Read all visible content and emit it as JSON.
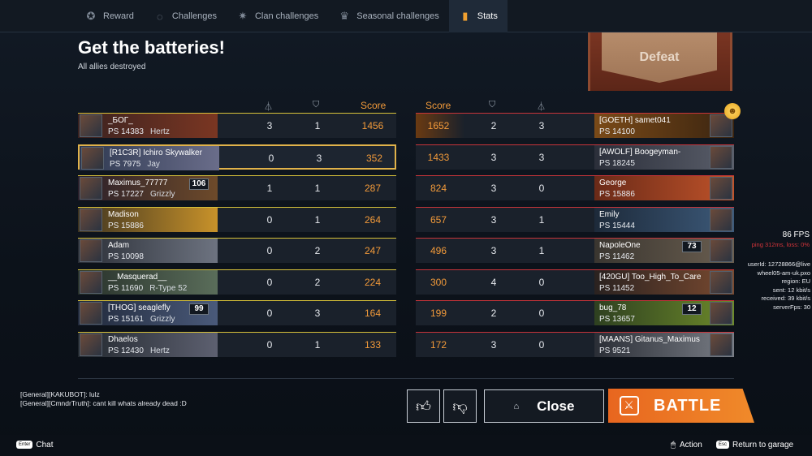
{
  "nav": {
    "tabs": [
      {
        "label": "Reward",
        "icon": "reward-icon"
      },
      {
        "label": "Challenges",
        "icon": "challenges-icon"
      },
      {
        "label": "Clan challenges",
        "icon": "clan-challenges-icon"
      },
      {
        "label": "Seasonal challenges",
        "icon": "seasonal-challenges-icon"
      },
      {
        "label": "Stats",
        "icon": "stats-icon"
      }
    ],
    "active": "Stats"
  },
  "mission": {
    "title": "Get the batteries!",
    "subtitle": "All allies destroyed"
  },
  "result": {
    "label": "Defeat"
  },
  "columns": {
    "score": "Score"
  },
  "colors": {
    "accent": "#f29a3a",
    "ally_line": "#d8c23a",
    "enemy_line": "#c8343a",
    "battle": "#ee7a26"
  },
  "allies": [
    {
      "name": "_БОГ_",
      "ps": "PS 14383",
      "vehicle": "Hertz",
      "level": "",
      "kills": "3",
      "assists": "1",
      "score": "1456"
    },
    {
      "name": "[R1C3R] Ichiro Skywalker",
      "ps": "PS 7975",
      "vehicle": "Jay",
      "level": "",
      "kills": "0",
      "assists": "3",
      "score": "352"
    },
    {
      "name": "Maximus_77777",
      "ps": "PS 17227",
      "vehicle": "Grizzly",
      "level": "106",
      "kills": "1",
      "assists": "1",
      "score": "287"
    },
    {
      "name": "Madison",
      "ps": "PS 15886",
      "vehicle": "",
      "level": "",
      "kills": "0",
      "assists": "1",
      "score": "264"
    },
    {
      "name": "Adam",
      "ps": "PS 10098",
      "vehicle": "",
      "level": "",
      "kills": "0",
      "assists": "2",
      "score": "247"
    },
    {
      "name": "__Masquerad__",
      "ps": "PS 11690",
      "vehicle": "R-Type 52",
      "level": "",
      "kills": "0",
      "assists": "2",
      "score": "224"
    },
    {
      "name": "[THOG] seaglefly",
      "ps": "PS 15161",
      "vehicle": "Grizzly",
      "level": "99",
      "kills": "0",
      "assists": "3",
      "score": "164"
    },
    {
      "name": "Dhaelos",
      "ps": "PS 12430",
      "vehicle": "Hertz",
      "level": "",
      "kills": "0",
      "assists": "1",
      "score": "133"
    }
  ],
  "enemies": [
    {
      "name": "[GOETH] samet041",
      "ps": "PS 14100",
      "level": "",
      "score": "1652",
      "assists": "2",
      "kills": "3"
    },
    {
      "name": "[AWOLF] Boogeyman-",
      "ps": "PS 18245",
      "level": "",
      "score": "1433",
      "assists": "3",
      "kills": "3"
    },
    {
      "name": "George",
      "ps": "PS 15886",
      "level": "",
      "score": "824",
      "assists": "3",
      "kills": "0"
    },
    {
      "name": "Emily",
      "ps": "PS 15444",
      "level": "",
      "score": "657",
      "assists": "3",
      "kills": "1"
    },
    {
      "name": "NapoleOne",
      "ps": "PS 11462",
      "level": "73",
      "score": "496",
      "assists": "3",
      "kills": "1"
    },
    {
      "name": "[420GU] Too_High_To_Care",
      "ps": "PS 11452",
      "level": "",
      "score": "300",
      "assists": "4",
      "kills": "0"
    },
    {
      "name": "bug_78",
      "ps": "PS 13657",
      "level": "12",
      "score": "199",
      "assists": "2",
      "kills": "0"
    },
    {
      "name": "[MAANS] Gitanus_Maximus",
      "ps": "PS 9521",
      "level": "",
      "score": "172",
      "assists": "3",
      "kills": "0"
    }
  ],
  "chat": {
    "lines": [
      "[General][KAKUBOT]: lulz",
      "[General][CmndrTruth]: cant kill whats already dead :D"
    ]
  },
  "actions": {
    "close": "Close",
    "battle": "BATTLE"
  },
  "bottom": {
    "chat_key": "Enter",
    "chat": "Chat",
    "action": "Action",
    "return_key": "Esc",
    "return": "Return to garage"
  },
  "perf": {
    "fps": "86 FPS",
    "ping": "ping 312ms, loss: 0%",
    "lines": [
      "userId: 12728866@live",
      "wheel05-am-uk.pxo",
      "region: EU",
      "sent: 12 kbit/s",
      "received: 39 kbit/s",
      "serverFps: 30"
    ]
  }
}
